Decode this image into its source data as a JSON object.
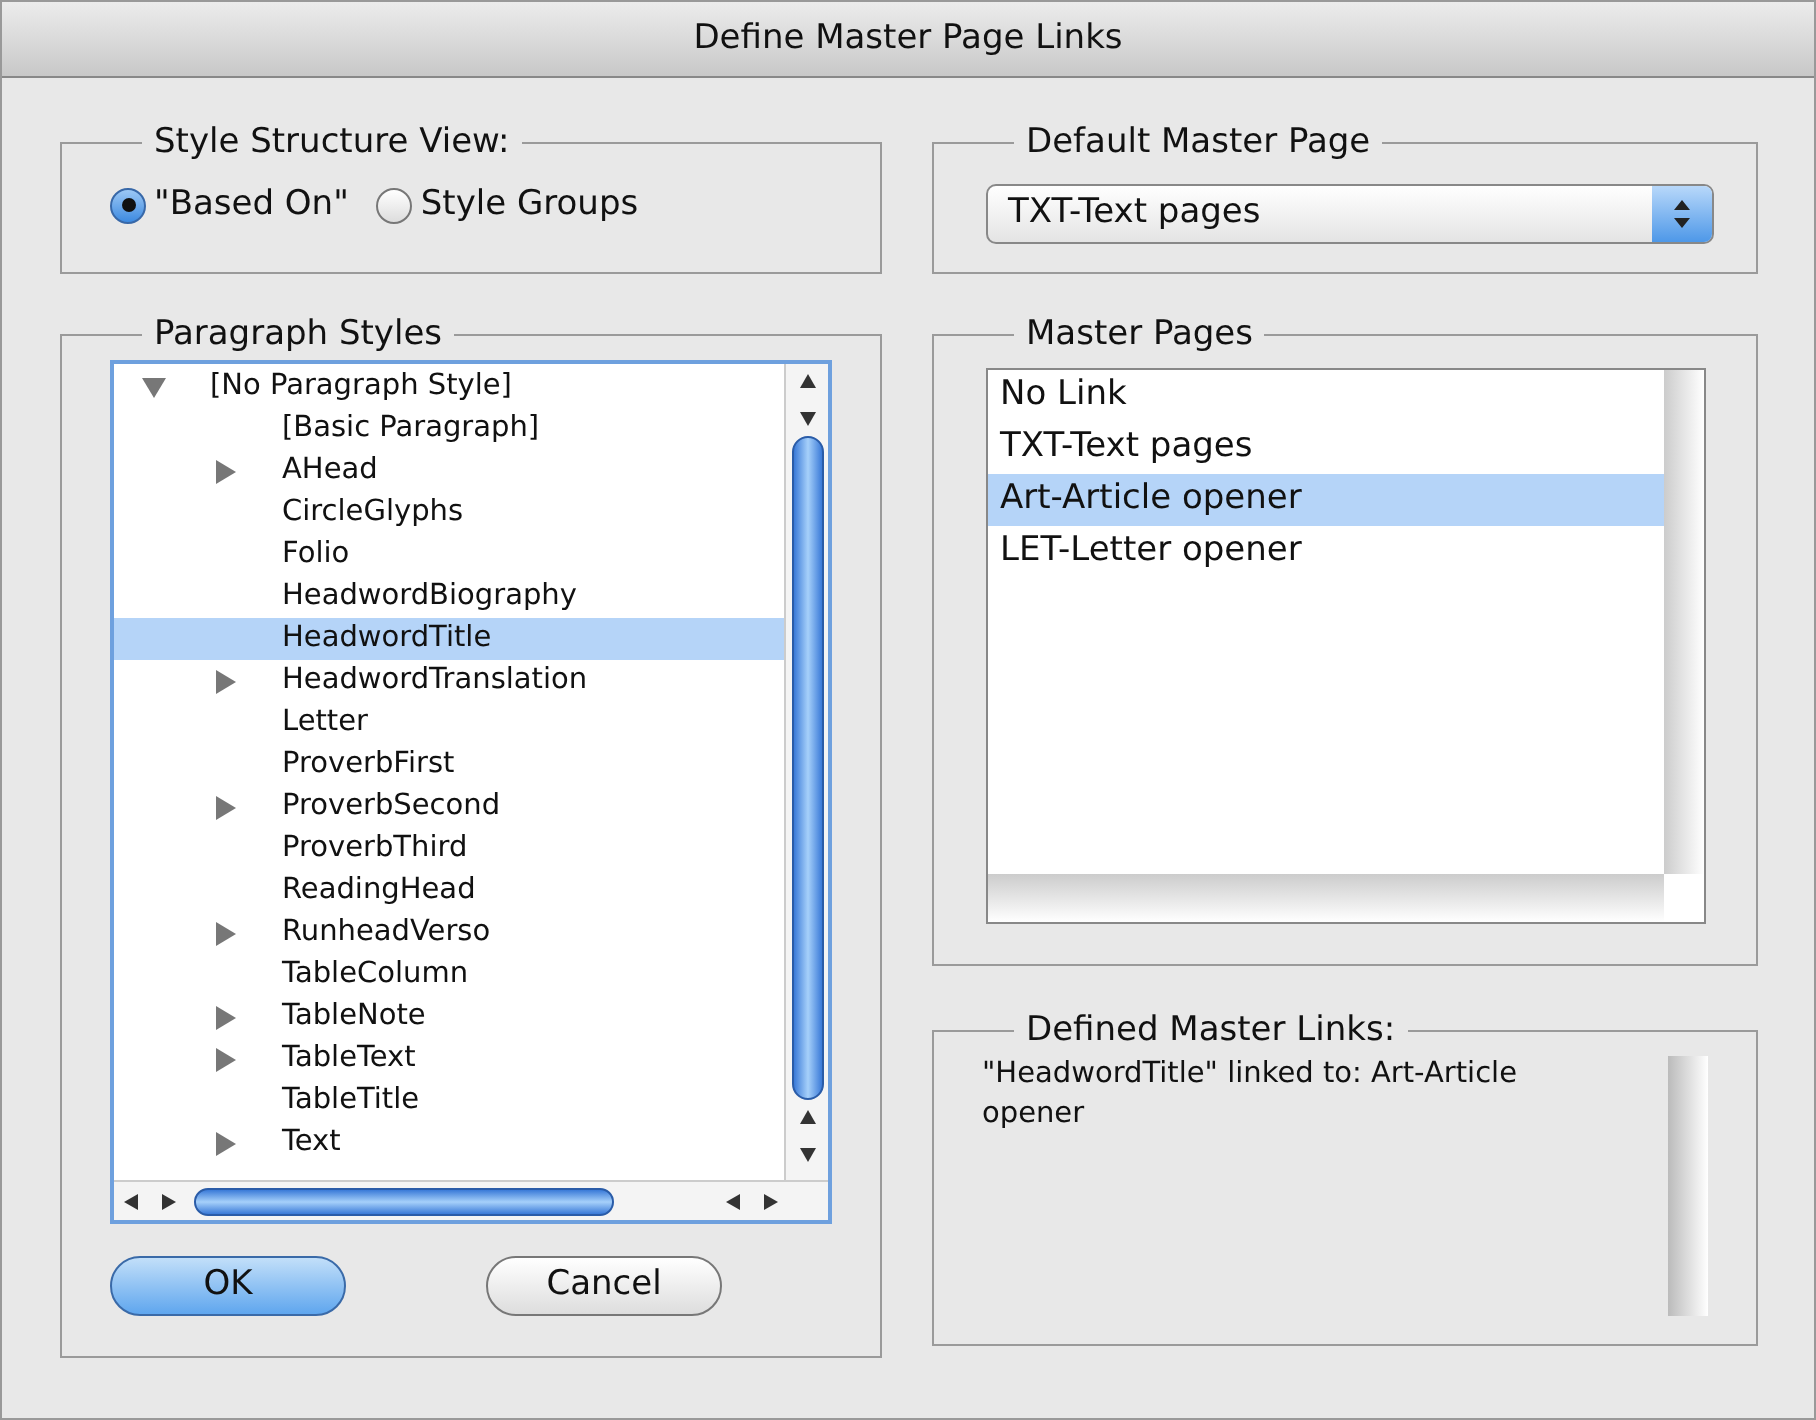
{
  "window": {
    "title": "Define Master Page Links"
  },
  "style_structure_view": {
    "label": "Style Structure View:",
    "options": [
      {
        "label": "\"Based On\"",
        "selected": true
      },
      {
        "label": "Style Groups",
        "selected": false
      }
    ]
  },
  "paragraph_styles": {
    "label": "Paragraph Styles",
    "items": [
      {
        "label": "[No Paragraph Style]",
        "kind": "folder",
        "expanded": true,
        "selected": false,
        "children": [
          {
            "label": "[Basic Paragraph]",
            "kind": "leaf",
            "selected": false
          },
          {
            "label": "AHead",
            "kind": "folder",
            "expanded": false,
            "selected": false
          },
          {
            "label": "CircleGlyphs",
            "kind": "leaf",
            "selected": false
          },
          {
            "label": "Folio",
            "kind": "leaf",
            "selected": false
          },
          {
            "label": "HeadwordBiography",
            "kind": "leaf",
            "selected": false
          },
          {
            "label": "HeadwordTitle",
            "kind": "leaf",
            "selected": true
          },
          {
            "label": "HeadwordTranslation",
            "kind": "folder",
            "expanded": false,
            "selected": false
          },
          {
            "label": "Letter",
            "kind": "leaf",
            "selected": false
          },
          {
            "label": "ProverbFirst",
            "kind": "leaf",
            "selected": false
          },
          {
            "label": "ProverbSecond",
            "kind": "folder",
            "expanded": false,
            "selected": false
          },
          {
            "label": "ProverbThird",
            "kind": "leaf",
            "selected": false
          },
          {
            "label": "ReadingHead",
            "kind": "leaf",
            "selected": false
          },
          {
            "label": "RunheadVerso",
            "kind": "folder",
            "expanded": false,
            "selected": false
          },
          {
            "label": "TableColumn",
            "kind": "leaf",
            "selected": false
          },
          {
            "label": "TableNote",
            "kind": "folder",
            "expanded": false,
            "selected": false
          },
          {
            "label": "TableText",
            "kind": "folder",
            "expanded": false,
            "selected": false
          },
          {
            "label": "TableTitle",
            "kind": "leaf",
            "selected": false
          },
          {
            "label": "Text",
            "kind": "folder",
            "expanded": false,
            "selected": false
          }
        ]
      }
    ]
  },
  "buttons": [
    {
      "label": "OK",
      "default": true
    },
    {
      "label": "Cancel",
      "default": false
    }
  ],
  "default_master_page": {
    "label": "Default Master Page",
    "value": "TXT-Text pages"
  },
  "master_pages": {
    "label": "Master Pages",
    "items": [
      {
        "label": "No Link",
        "selected": false
      },
      {
        "label": "TXT-Text pages",
        "selected": false
      },
      {
        "label": "Art-Article opener",
        "selected": true
      },
      {
        "label": "LET-Letter opener",
        "selected": false
      }
    ]
  },
  "defined_master_links": {
    "label": "Defined Master Links:",
    "text": "\"HeadwordTitle\" linked to: Art-Article opener"
  }
}
